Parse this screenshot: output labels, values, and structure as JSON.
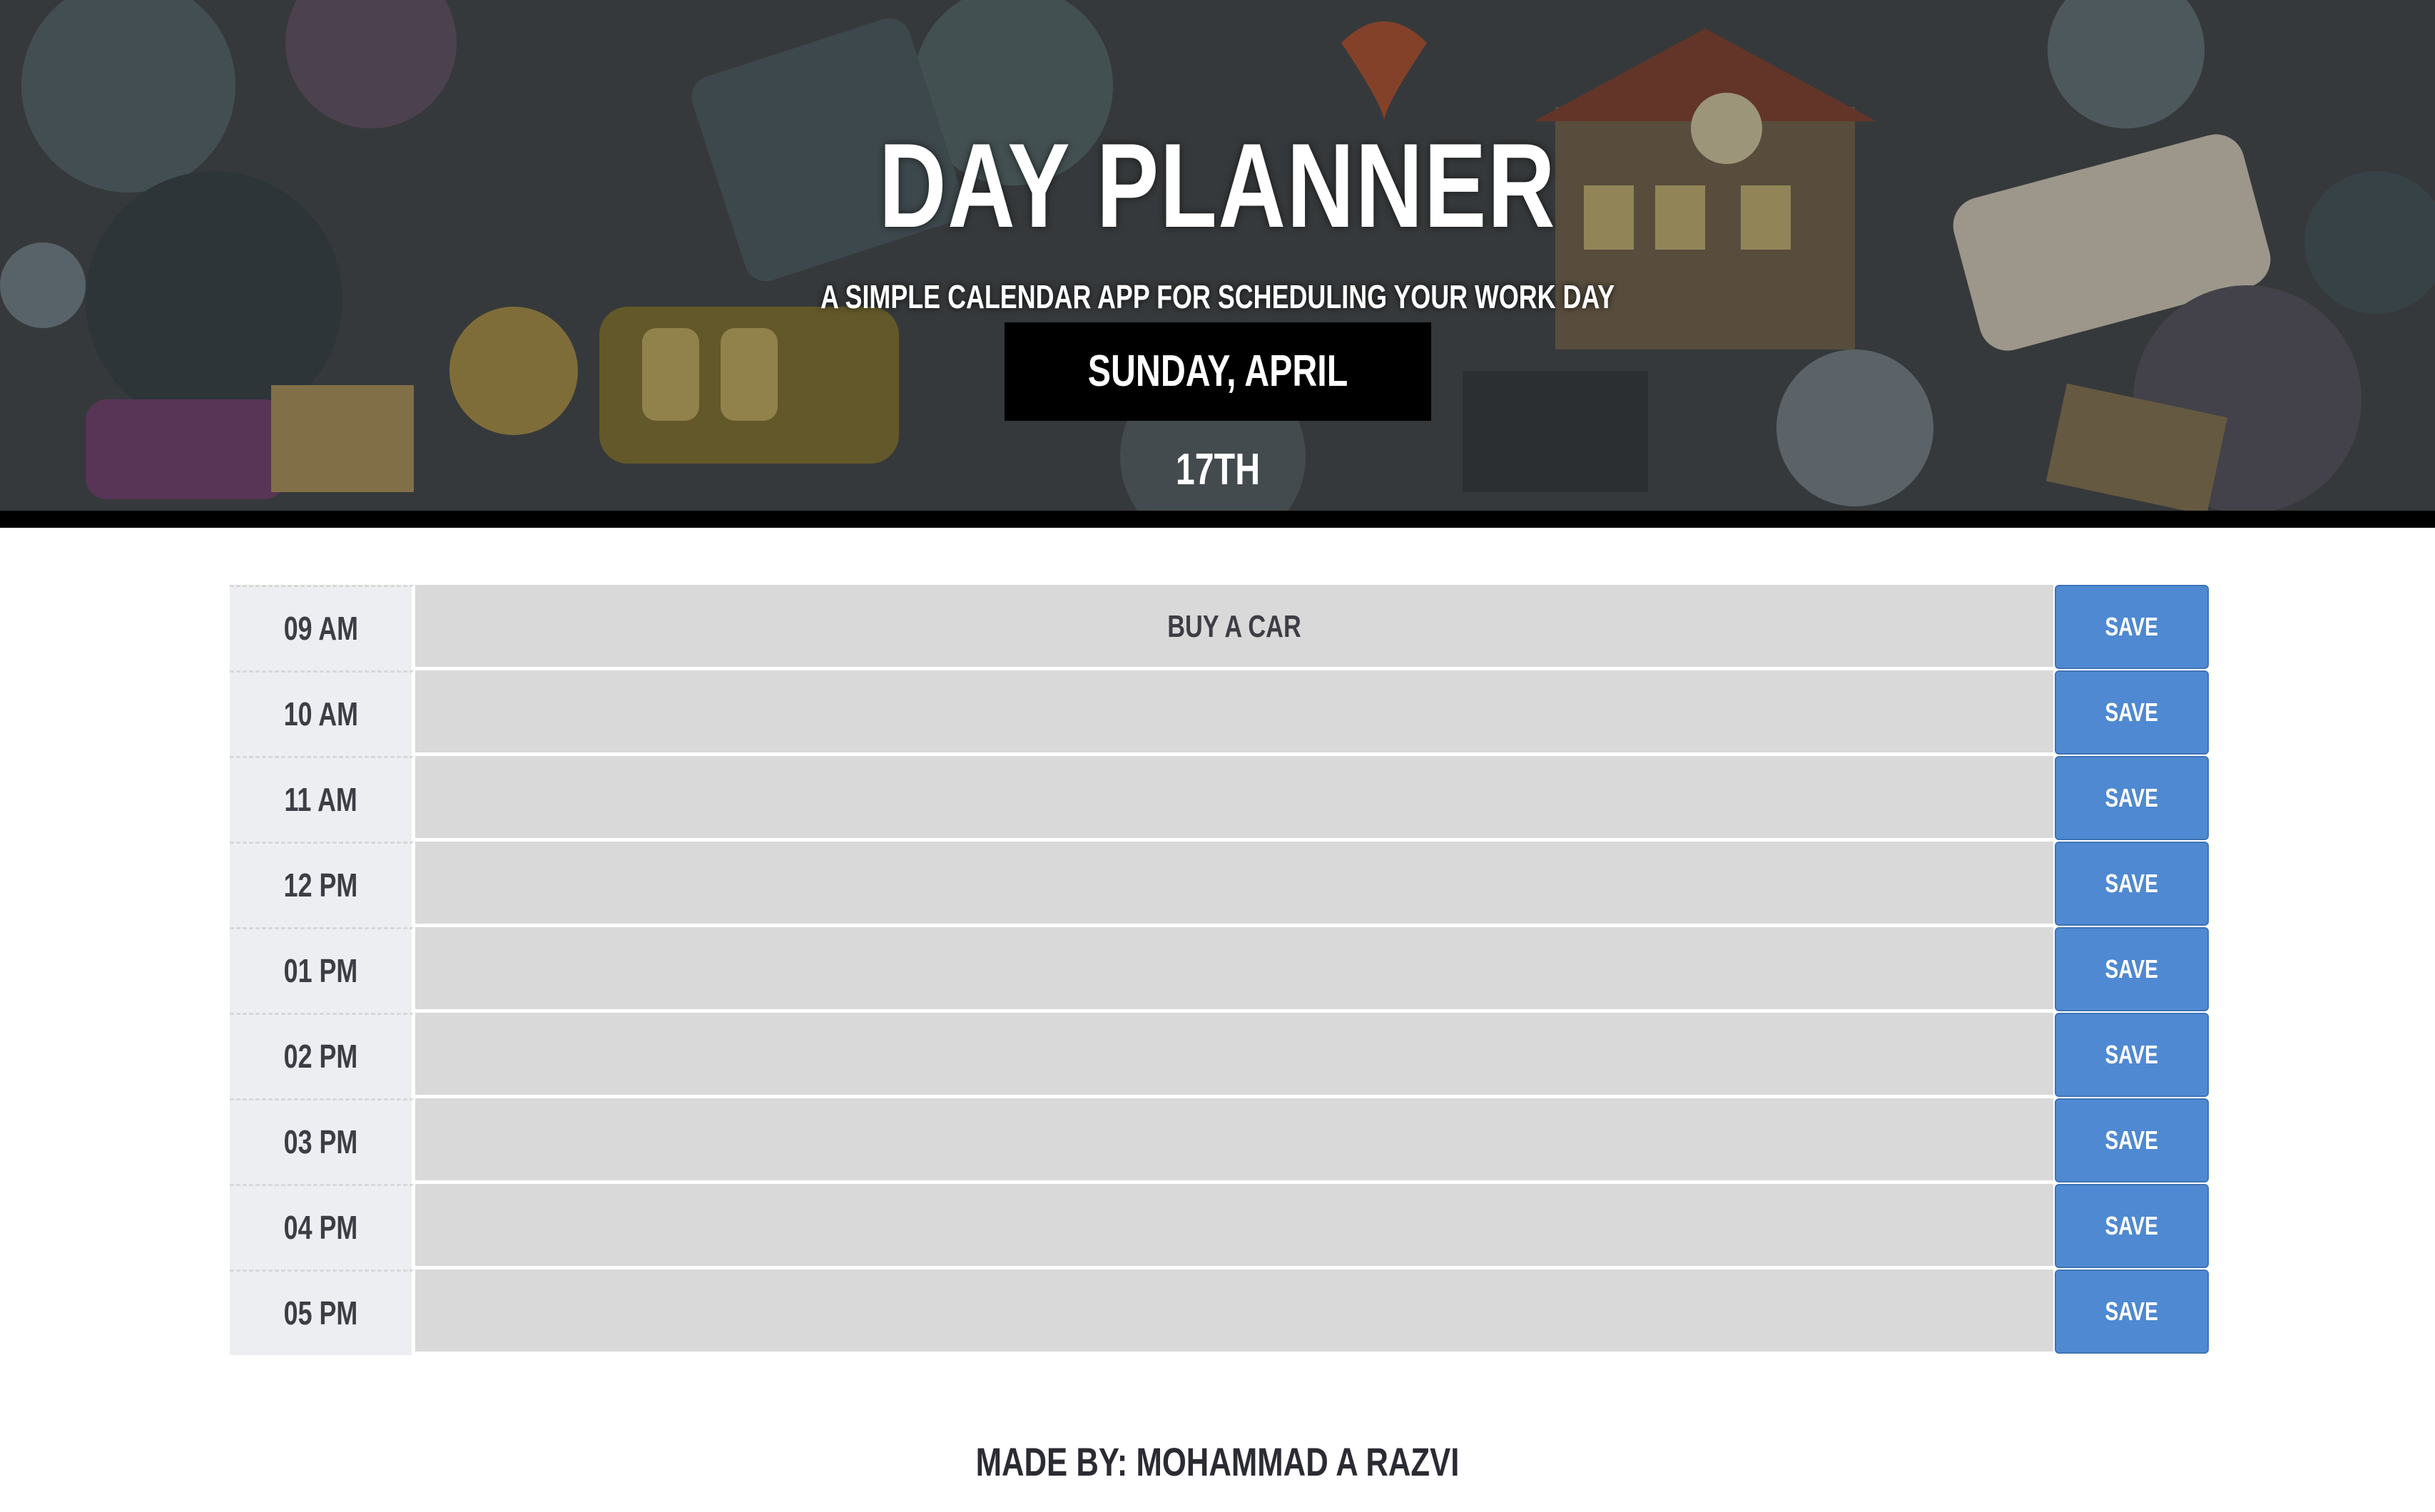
{
  "header": {
    "title": "Day Planner",
    "subtitle": "A simple calendar app for scheduling your work day",
    "current_day": "Sunday, April 17th"
  },
  "timeblocks": [
    {
      "hour": "09 AM",
      "description": "BUY A CAR",
      "save_label": "SAVE"
    },
    {
      "hour": "10 AM",
      "description": "",
      "save_label": "SAVE"
    },
    {
      "hour": "11 AM",
      "description": "",
      "save_label": "SAVE"
    },
    {
      "hour": "12 PM",
      "description": "",
      "save_label": "SAVE"
    },
    {
      "hour": "01 PM",
      "description": "",
      "save_label": "SAVE"
    },
    {
      "hour": "02 PM",
      "description": "",
      "save_label": "SAVE"
    },
    {
      "hour": "03 PM",
      "description": "",
      "save_label": "SAVE"
    },
    {
      "hour": "04 PM",
      "description": "",
      "save_label": "SAVE"
    },
    {
      "hour": "05 PM",
      "description": "",
      "save_label": "SAVE"
    }
  ],
  "footer": {
    "credit": "Made by: Mohammad A Razvi"
  },
  "colors": {
    "save_button": "#4f89d1",
    "description_bg": "#d9d9d9",
    "hour_bg": "#eceef2",
    "current_day_bg": "#000000"
  }
}
